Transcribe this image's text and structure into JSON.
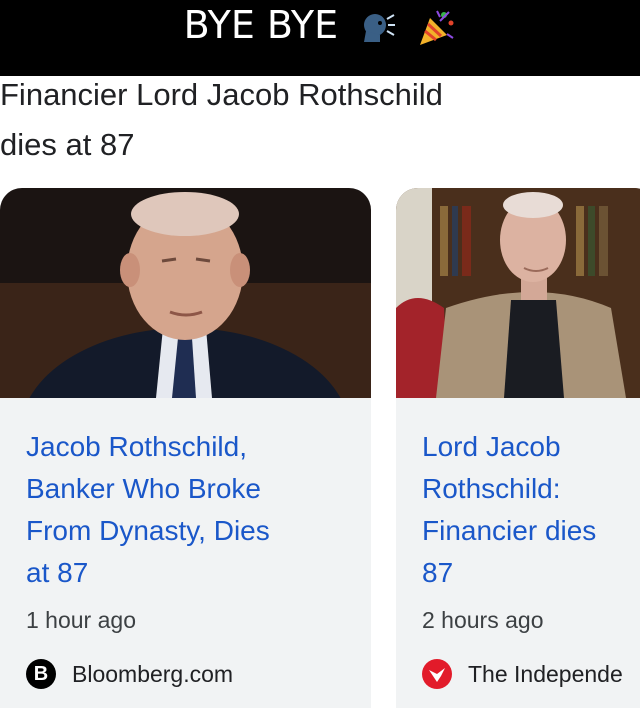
{
  "caption": {
    "text": "BYE BYE"
  },
  "headline": {
    "line1": "Financier Lord Jacob Rothschild",
    "line2": "dies at 87"
  },
  "cards": [
    {
      "title_lines": [
        "Jacob Rothschild,",
        "Banker Who Broke",
        "From Dynasty, Dies",
        "at 87"
      ],
      "time": "1 hour ago",
      "source": "Bloomberg.com",
      "source_icon": "B"
    },
    {
      "title_lines": [
        "Lord Jacob",
        "Rothschild:",
        "Financier dies",
        "87"
      ],
      "time": "2 hours ago",
      "source": "The Independe"
    }
  ]
}
